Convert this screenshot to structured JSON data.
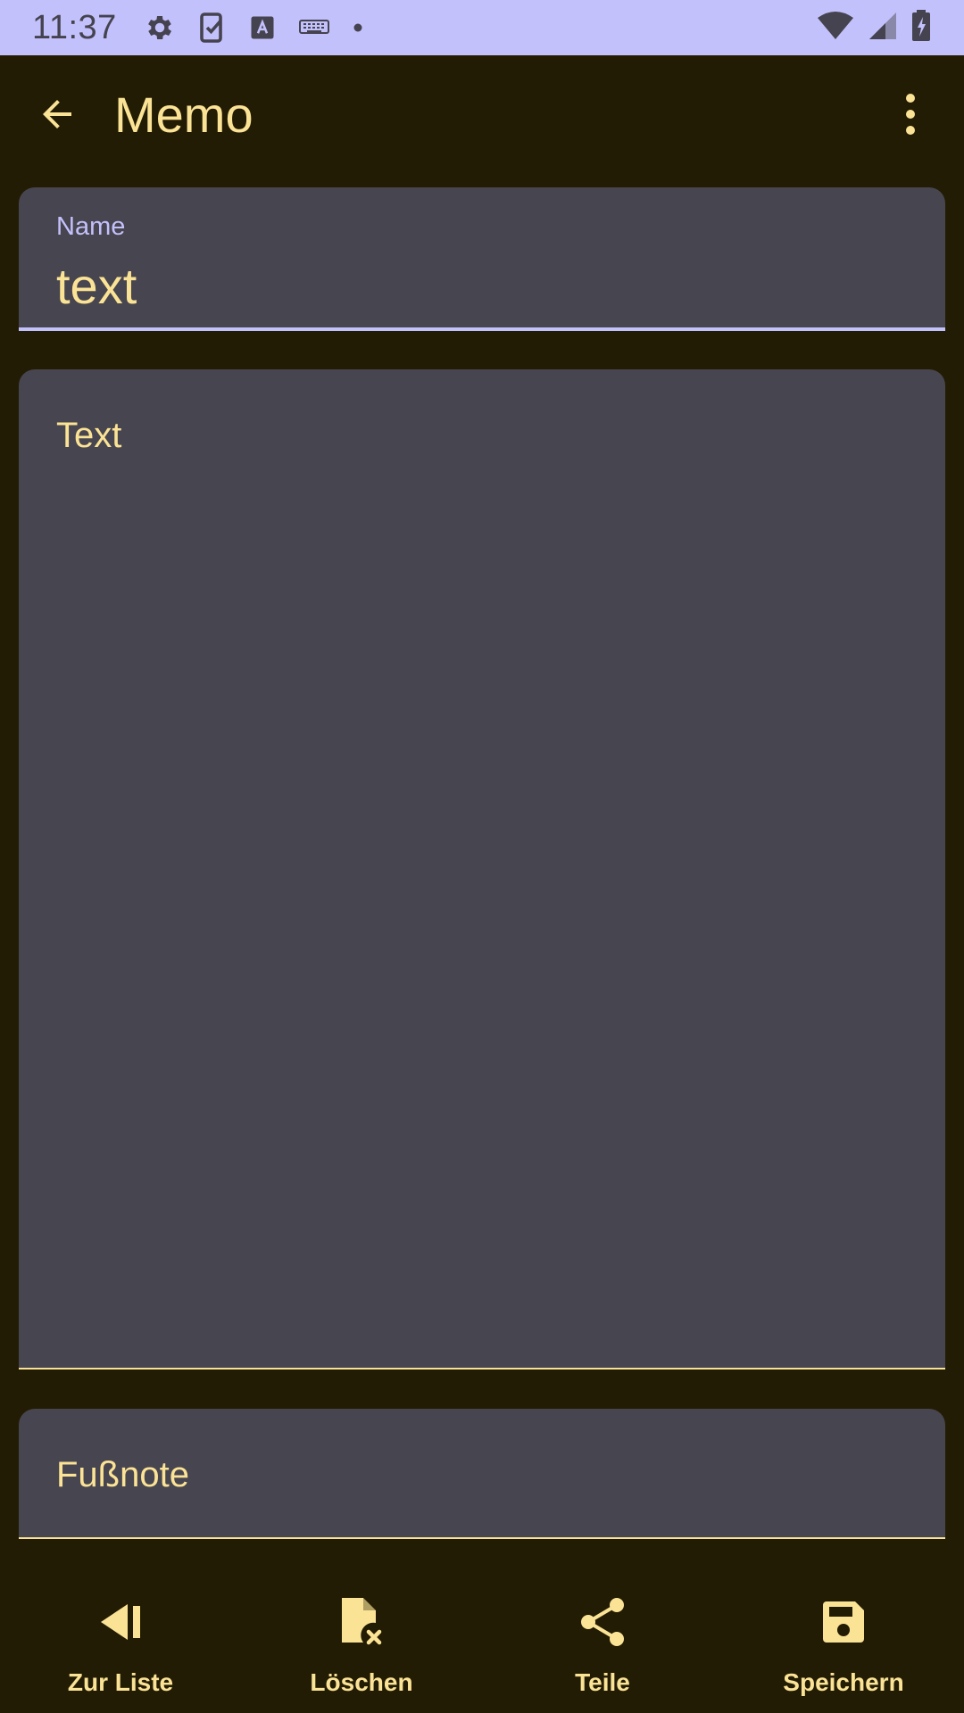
{
  "status_bar": {
    "time": "11:37",
    "left_icons": [
      "settings-icon",
      "task-icon",
      "text-box-icon",
      "keyboard-icon",
      "dot-icon"
    ],
    "right_icons": [
      "wifi-icon",
      "signal-icon",
      "battery-charging-icon"
    ]
  },
  "app_bar": {
    "title": "Memo",
    "back_icon": "arrow-back-icon",
    "menu_icon": "more-vert-icon"
  },
  "fields": {
    "name": {
      "label": "Name",
      "value": "text"
    },
    "text": {
      "placeholder": "Text"
    },
    "footnote": {
      "placeholder": "Fußnote"
    }
  },
  "bottom_nav": {
    "items": [
      {
        "label": "Zur Liste",
        "icon": "skip-back-icon"
      },
      {
        "label": "Löschen",
        "icon": "file-delete-icon"
      },
      {
        "label": "Teile",
        "icon": "share-icon"
      },
      {
        "label": "Speichern",
        "icon": "save-icon"
      }
    ]
  },
  "colors": {
    "background": "#231c04",
    "status_bar": "#c3c1fb",
    "accent_text": "#fbe396",
    "field_bg": "#47454f",
    "focus_line": "#c3c1fb"
  }
}
